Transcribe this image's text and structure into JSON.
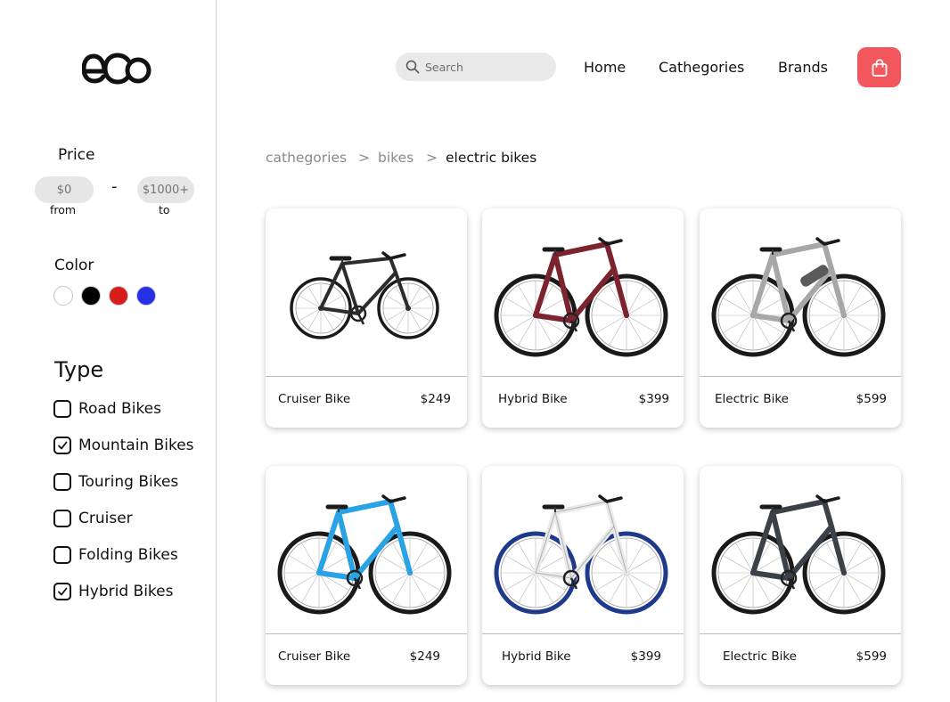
{
  "sidebar": {
    "logo_text": "eCo",
    "price": {
      "title": "Price",
      "from_placeholder": "$0",
      "to_placeholder": "$1000+",
      "separator": "-",
      "from_label": "from",
      "to_label": "to"
    },
    "color": {
      "title": "Color",
      "swatches": [
        {
          "name": "white",
          "hex": "#ffffff"
        },
        {
          "name": "black",
          "hex": "#000000"
        },
        {
          "name": "red",
          "hex": "#d81c1c"
        },
        {
          "name": "blue",
          "hex": "#2431e6"
        }
      ]
    },
    "type": {
      "title": "Type",
      "items": [
        {
          "label": "Road Bikes",
          "checked": false
        },
        {
          "label": "Mountain Bikes",
          "checked": true
        },
        {
          "label": "Touring Bikes",
          "checked": false
        },
        {
          "label": "Cruiser",
          "checked": false
        },
        {
          "label": "Folding Bikes",
          "checked": false
        },
        {
          "label": "Hybrid Bikes",
          "checked": true
        }
      ]
    }
  },
  "header": {
    "search_placeholder": "Search",
    "nav": [
      "Home",
      "Cathegories",
      "Brands"
    ],
    "cart_icon": "shopping-bag-icon",
    "accent_color": "#f2575d"
  },
  "breadcrumb": {
    "items": [
      "cathegories",
      "bikes",
      "electric bikes"
    ],
    "separator": ">"
  },
  "products": [
    {
      "name": "Cruiser Bike",
      "price": "$249",
      "frame_color": "#2c2c2c"
    },
    {
      "name": "Hybrid Bike",
      "price": "$399",
      "frame_color": "#7b2430"
    },
    {
      "name": "Electric Bike",
      "price": "$599",
      "frame_color": "#a7a7a7"
    },
    {
      "name": "Cruiser Bike",
      "price": "$249",
      "frame_color": "#2aa3e6"
    },
    {
      "name": "Hybrid Bike",
      "price": "$399",
      "frame_color": "#e9e9e9"
    },
    {
      "name": "Electric Bike",
      "price": "$599",
      "frame_color": "#3b4148"
    }
  ]
}
